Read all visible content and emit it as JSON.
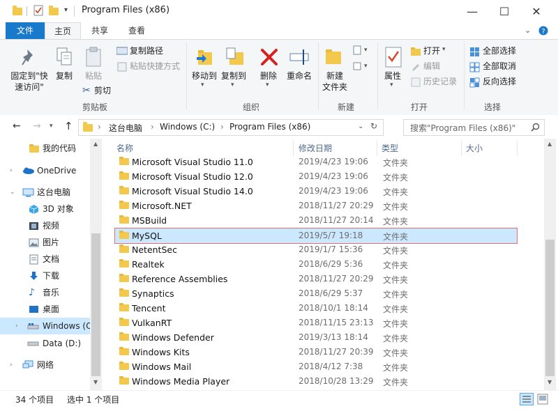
{
  "window": {
    "title": "Program Files (x86)",
    "minimize_glyph": "—",
    "maximize_glyph": "☐",
    "close_glyph": "✕"
  },
  "ribbon_tabs": [
    "文件",
    "主页",
    "共享",
    "查看"
  ],
  "ribbon": {
    "pin_quick_access": "固定到\"快速访问\"",
    "copy": "复制",
    "paste": "粘贴",
    "copy_path": "复制路径",
    "paste_shortcut": "粘贴快捷方式",
    "cut": "剪切",
    "clipboard_group": "剪贴板",
    "move_to": "移动到",
    "copy_to": "复制到",
    "delete": "删除",
    "rename": "重命名",
    "organize_group": "组织",
    "new_folder": "新建\n文件夹",
    "new_group": "新建",
    "properties": "属性",
    "open": "打开",
    "edit": "编辑",
    "history": "历史记录",
    "open_group": "打开",
    "select_all": "全部选择",
    "select_none": "全部取消",
    "invert_selection": "反向选择",
    "select_group": "选择"
  },
  "address": {
    "crumbs": [
      "这台电脑",
      "Windows (C:)",
      "Program Files (x86)"
    ],
    "search_placeholder": "搜索\"Program Files (x86)\""
  },
  "nav_items": [
    {
      "label": "我的代码",
      "icon": "folder-icon"
    },
    {
      "label": "OneDrive",
      "icon": "cloud-icon"
    },
    {
      "label": "这台电脑",
      "icon": "computer-icon"
    },
    {
      "label": "3D 对象",
      "icon": "cube-icon"
    },
    {
      "label": "视频",
      "icon": "video-icon"
    },
    {
      "label": "图片",
      "icon": "picture-icon"
    },
    {
      "label": "文档",
      "icon": "document-icon"
    },
    {
      "label": "下载",
      "icon": "download-icon"
    },
    {
      "label": "音乐",
      "icon": "music-icon"
    },
    {
      "label": "桌面",
      "icon": "desktop-icon"
    },
    {
      "label": "Windows (C",
      "icon": "drive-icon"
    },
    {
      "label": "Data (D:)",
      "icon": "drive-icon"
    },
    {
      "label": "网络",
      "icon": "network-icon"
    }
  ],
  "columns": [
    "名称",
    "修改日期",
    "类型",
    "大小"
  ],
  "files": [
    {
      "name": "Microsoft Visual Studio 11.0",
      "date": "2019/4/23 19:06",
      "type": "文件夹"
    },
    {
      "name": "Microsoft Visual Studio 12.0",
      "date": "2019/4/23 19:06",
      "type": "文件夹"
    },
    {
      "name": "Microsoft Visual Studio 14.0",
      "date": "2019/4/23 19:06",
      "type": "文件夹"
    },
    {
      "name": "Microsoft.NET",
      "date": "2018/11/27 20:29",
      "type": "文件夹"
    },
    {
      "name": "MSBuild",
      "date": "2018/11/27 20:14",
      "type": "文件夹"
    },
    {
      "name": "MySQL",
      "date": "2019/5/7 19:18",
      "type": "文件夹"
    },
    {
      "name": "NetentSec",
      "date": "2019/1/7 15:36",
      "type": "文件夹"
    },
    {
      "name": "Realtek",
      "date": "2018/6/29 5:36",
      "type": "文件夹"
    },
    {
      "name": "Reference Assemblies",
      "date": "2018/11/27 20:29",
      "type": "文件夹"
    },
    {
      "name": "Synaptics",
      "date": "2018/6/29 5:37",
      "type": "文件夹"
    },
    {
      "name": "Tencent",
      "date": "2018/10/1 18:14",
      "type": "文件夹"
    },
    {
      "name": "VulkanRT",
      "date": "2018/11/15 23:13",
      "type": "文件夹"
    },
    {
      "name": "Windows Defender",
      "date": "2019/3/13 18:14",
      "type": "文件夹"
    },
    {
      "name": "Windows Kits",
      "date": "2018/11/27 20:39",
      "type": "文件夹"
    },
    {
      "name": "Windows Mail",
      "date": "2018/4/12 7:38",
      "type": "文件夹"
    },
    {
      "name": "Windows Media Player",
      "date": "2018/10/28 13:29",
      "type": "文件夹"
    }
  ],
  "selected_file_index": 5,
  "status": {
    "item_count": "34 个项目",
    "selection": "选中 1 个项目"
  },
  "colors": {
    "file_tab": "#1979ca",
    "selection": "#cce8ff",
    "folder": "#f2c94c",
    "selection_outline": "#e07070"
  }
}
